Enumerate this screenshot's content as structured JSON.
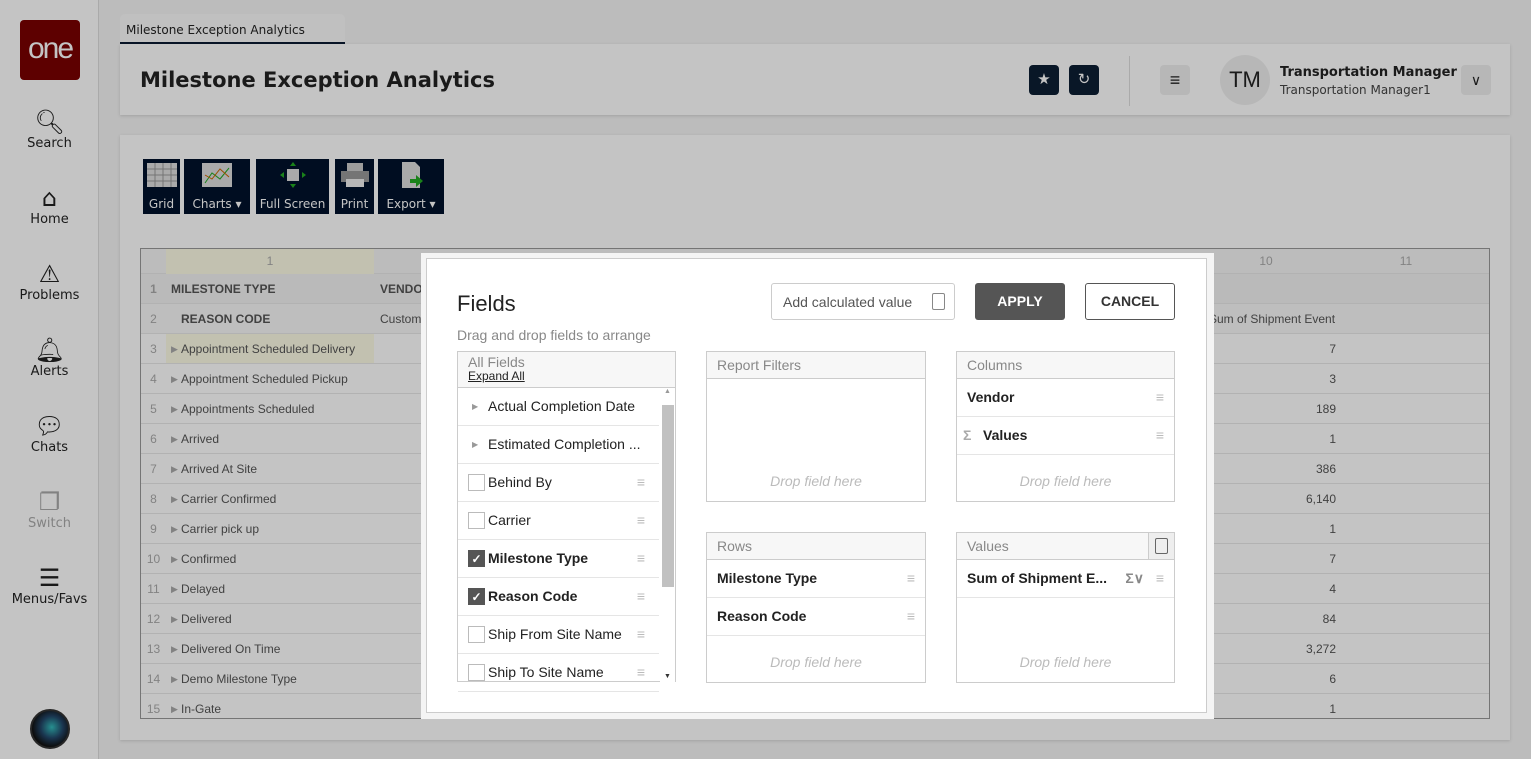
{
  "sidebar": {
    "logo": "one",
    "items": [
      {
        "label": "Search",
        "icon": "search-icon"
      },
      {
        "label": "Home",
        "icon": "home-icon"
      },
      {
        "label": "Problems",
        "icon": "warning-icon"
      },
      {
        "label": "Alerts",
        "icon": "bell-icon"
      },
      {
        "label": "Chats",
        "icon": "chat-icon"
      },
      {
        "label": "Switch",
        "icon": "switch-icon"
      },
      {
        "label": "Menus/Favs",
        "icon": "menu-icon"
      }
    ]
  },
  "tab": {
    "label": "Milestone Exception Analytics"
  },
  "header": {
    "title": "Milestone Exception Analytics",
    "user_initials": "TM",
    "user_name": "Transportation Manager",
    "user_role": "Transportation Manager1"
  },
  "toolbar": {
    "grid": "Grid",
    "charts": "Charts",
    "full_screen": "Full Screen",
    "print": "Print",
    "export": "Export"
  },
  "grid": {
    "col_numbers": [
      "1",
      "10",
      "11"
    ],
    "row1_label": "MILESTONE TYPE",
    "row1_col2": "VENDOR",
    "row2_label": "REASON CODE",
    "row2_col2": "Customer",
    "value_header": "Sum of Shipment Event",
    "rows": [
      {
        "n": "3",
        "label": "Appointment Scheduled Delivery",
        "value": "7"
      },
      {
        "n": "4",
        "label": "Appointment Scheduled Pickup",
        "value": "3"
      },
      {
        "n": "5",
        "label": "Appointments Scheduled",
        "value": "189"
      },
      {
        "n": "6",
        "label": "Arrived",
        "value": "1"
      },
      {
        "n": "7",
        "label": "Arrived At Site",
        "value": "386"
      },
      {
        "n": "8",
        "label": "Carrier Confirmed",
        "value": "6,140"
      },
      {
        "n": "9",
        "label": "Carrier pick up",
        "value": "1"
      },
      {
        "n": "10",
        "label": "Confirmed",
        "value": "7"
      },
      {
        "n": "11",
        "label": "Delayed",
        "value": "4"
      },
      {
        "n": "12",
        "label": "Delivered",
        "value": "84"
      },
      {
        "n": "13",
        "label": "Delivered On Time",
        "value": "3,272"
      },
      {
        "n": "14",
        "label": "Demo Milestone Type",
        "value": "6"
      },
      {
        "n": "15",
        "label": "In-Gate",
        "value": "1"
      }
    ]
  },
  "modal": {
    "title": "Fields",
    "subtitle": "Drag and drop fields to arrange",
    "add_calc": "Add calculated value",
    "apply": "APPLY",
    "cancel": "CANCEL",
    "all_fields": {
      "title": "All Fields",
      "expand_all": "Expand All",
      "items": [
        {
          "label": "Actual Completion Date",
          "type": "group"
        },
        {
          "label": "Estimated Completion ...",
          "type": "group"
        },
        {
          "label": "Behind By",
          "checked": false
        },
        {
          "label": "Carrier",
          "checked": false
        },
        {
          "label": "Milestone Type",
          "checked": true
        },
        {
          "label": "Reason Code",
          "checked": true
        },
        {
          "label": "Ship From Site Name",
          "checked": false
        },
        {
          "label": "Ship To Site Name",
          "checked": false
        }
      ]
    },
    "report_filters": {
      "title": "Report Filters",
      "drop": "Drop field here"
    },
    "columns": {
      "title": "Columns",
      "items": [
        "Vendor",
        "Values"
      ],
      "drop": "Drop field here"
    },
    "rows": {
      "title": "Rows",
      "items": [
        "Milestone Type",
        "Reason Code"
      ],
      "drop": "Drop field here"
    },
    "values": {
      "title": "Values",
      "items": [
        "Sum of Shipment E..."
      ],
      "drop": "Drop field here"
    }
  }
}
